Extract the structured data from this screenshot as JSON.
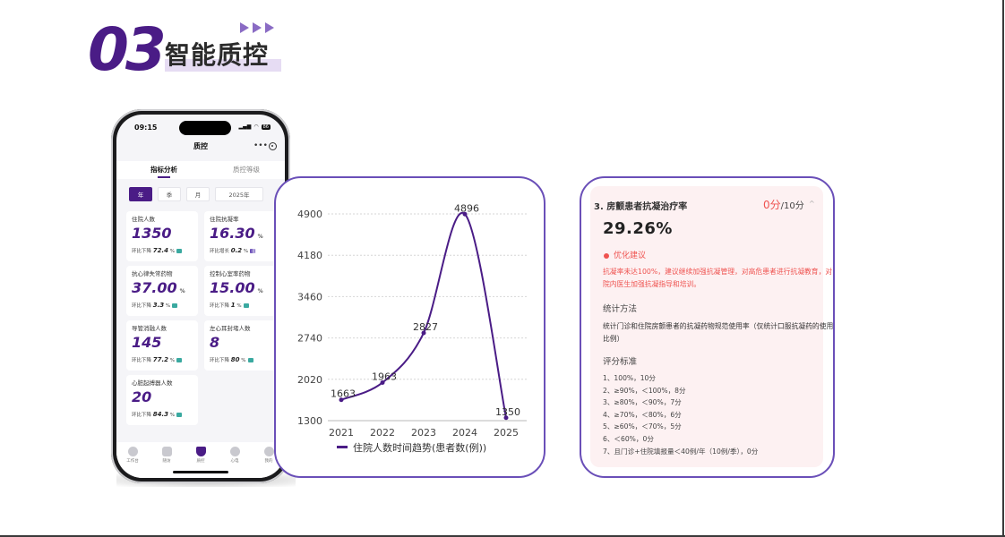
{
  "header": {
    "section_number": "03",
    "section_title": "智能质控"
  },
  "phone": {
    "status_time": "09:15",
    "battery": "86",
    "app_title": "质控",
    "tabs": [
      "指标分析",
      "质控等级"
    ],
    "period_chips": [
      "年",
      "季",
      "月"
    ],
    "year_chip": "2025年",
    "metrics": [
      {
        "label": "住院人数",
        "value": "1350",
        "unit": "",
        "trend_label": "环比下降",
        "trend_value": "72.4",
        "trend_unit": "%"
      },
      {
        "label": "住院抗凝率",
        "value": "16.30",
        "unit": "%",
        "trend_label": "环比增长",
        "trend_value": "0.2",
        "trend_unit": "%"
      },
      {
        "label": "抗心律失常药物",
        "value": "37.00",
        "unit": "%",
        "trend_label": "环比下降",
        "trend_value": "3.3",
        "trend_unit": "%"
      },
      {
        "label": "控制心室率药物",
        "value": "15.00",
        "unit": "%",
        "trend_label": "环比下降",
        "trend_value": "1",
        "trend_unit": "%"
      },
      {
        "label": "导管消融人数",
        "value": "145",
        "unit": "",
        "trend_label": "环比下降",
        "trend_value": "77.2",
        "trend_unit": "%"
      },
      {
        "label": "左心耳封堵人数",
        "value": "8",
        "unit": "",
        "trend_label": "环比下降",
        "trend_value": "80",
        "trend_unit": "%"
      },
      {
        "label": "心脏起搏器人数",
        "value": "20",
        "unit": "",
        "trend_label": "环比下降",
        "trend_value": "84.3",
        "trend_unit": "%"
      }
    ],
    "bottom_nav": [
      "工作台",
      "随访",
      "质控",
      "心电",
      "我的"
    ]
  },
  "chart_data": {
    "type": "line",
    "categories": [
      "2021",
      "2022",
      "2023",
      "2024",
      "2025"
    ],
    "series": [
      {
        "name": "住院人数时间趋势(患者数(例))",
        "values": [
          1663,
          1963,
          2827,
          4896,
          1350
        ]
      }
    ],
    "data_labels": [
      "1663",
      "1963",
      "2827",
      "4896",
      "1350"
    ],
    "ylim": [
      1300,
      4900
    ],
    "yticks": [
      "1300",
      "2020",
      "2740",
      "3460",
      "4180",
      "4900"
    ],
    "grid": true,
    "legend_position": "bottom",
    "color": "#4a1c86"
  },
  "detail": {
    "title": "3. 房颤患者抗凝治疗率",
    "score": "0分",
    "score_total": "/10分",
    "rate": "29.26%",
    "suggestion_title": "优化建议",
    "suggestion_text": "抗凝率未达100%，建议继续加强抗凝管理，对高危患者进行抗凝教育，对院内医生加强抗凝指导和培训。",
    "stat_title": "统计方法",
    "stat_text": "统计门诊和住院房颤患者的抗凝药物规范使用率（仅统计口服抗凝药的使用比例）",
    "scoring_title": "评分标准",
    "scoring": [
      "1、100%，10分",
      "2、≥90%，＜100%，8分",
      "3、≥80%，＜90%，7分",
      "4、≥70%，＜80%，6分",
      "5、≥60%，＜70%，5分",
      "6、＜60%，0分",
      "7、且门诊+住院填报量＜40例/年（10例/季），0分"
    ]
  }
}
